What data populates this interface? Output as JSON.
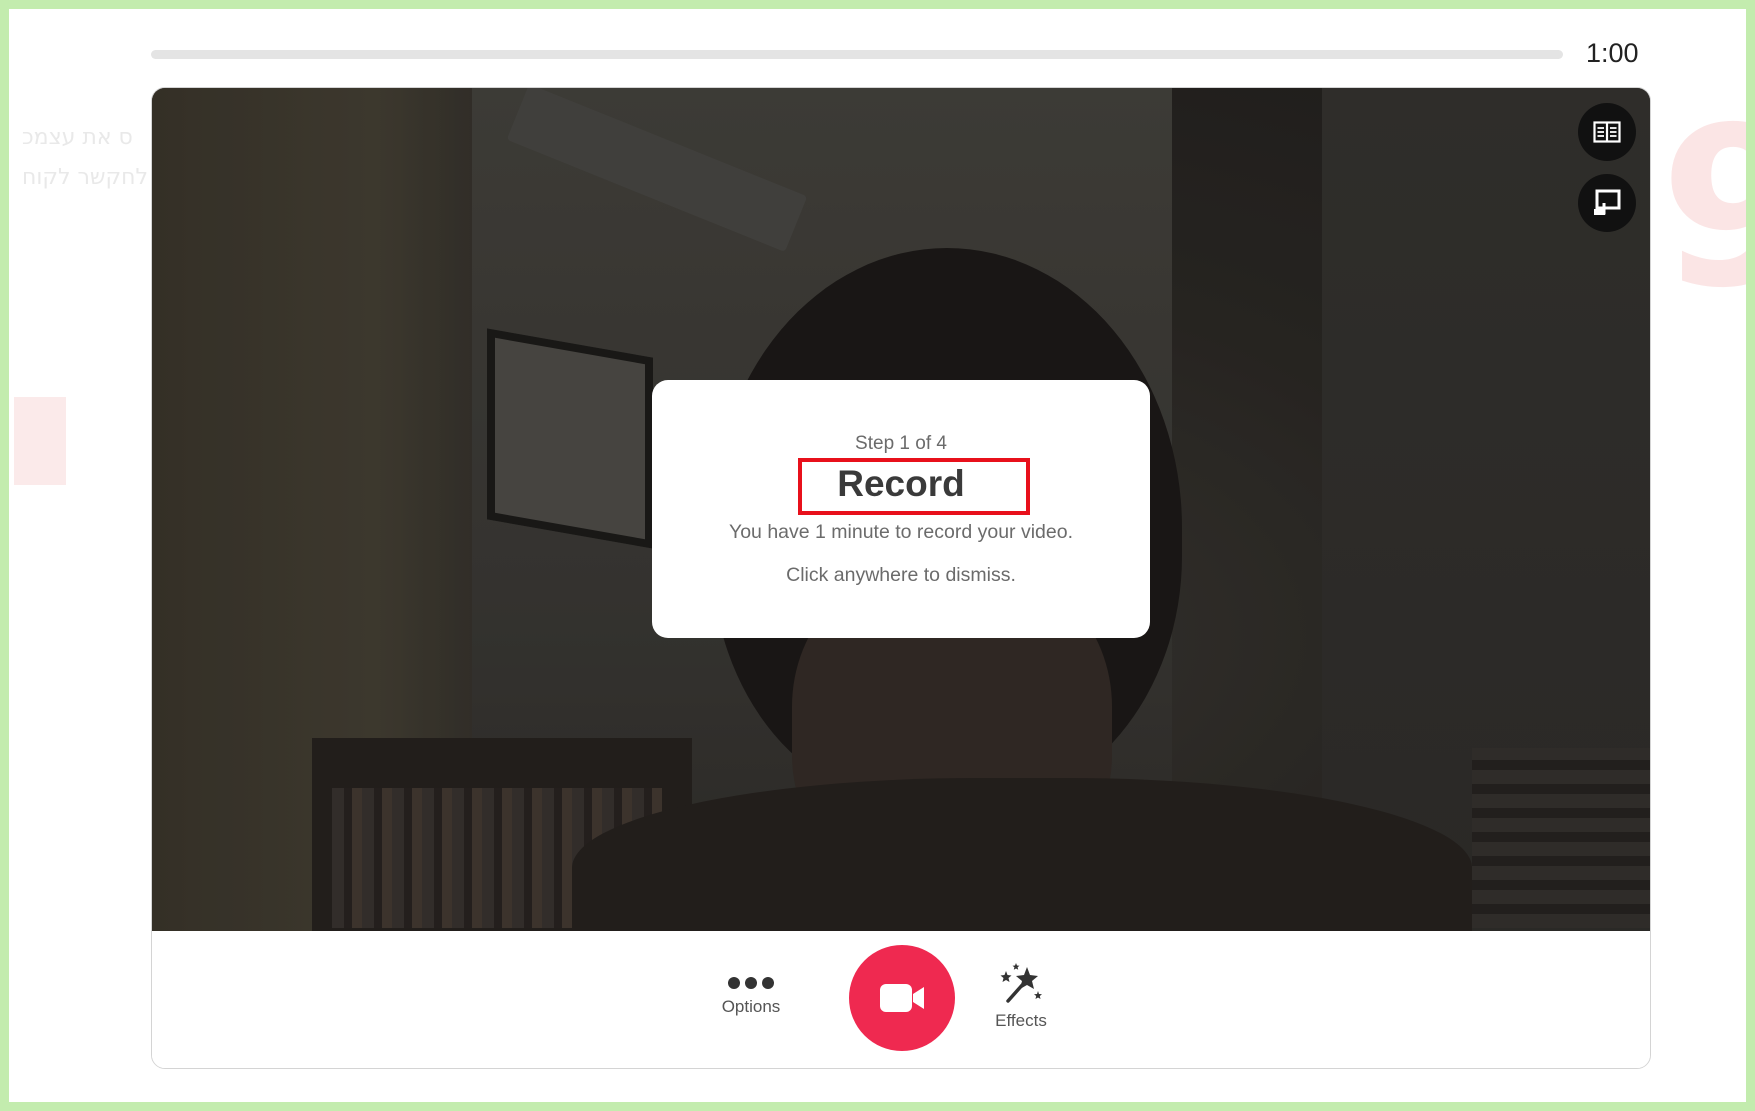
{
  "recorder": {
    "timer": "1:00",
    "progress_fraction": 0
  },
  "onboarding": {
    "step": "Step 1 of 4",
    "title": "Record",
    "description": "You have 1 minute to record your video.",
    "dismiss_hint": "Click anywhere to dismiss."
  },
  "side_buttons": [
    {
      "icon": "teleprompter-book-icon"
    },
    {
      "icon": "screen-share-icon"
    }
  ],
  "controls": {
    "options_label": "Options",
    "effects_label": "Effects",
    "record_icon": "video-camera-icon"
  },
  "colors": {
    "record_button": "#ef2950",
    "highlight_box": "#e8101b",
    "frame_border": "#c3ecae"
  }
}
